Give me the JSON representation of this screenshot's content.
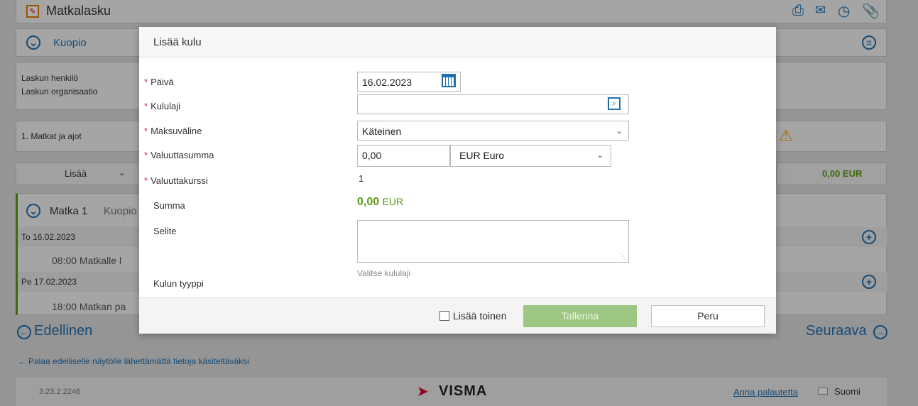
{
  "background": {
    "app_title": "Matkalasku",
    "location": "Kuopio",
    "person_label": "Laskun henkilö",
    "org_label": "Laskun organisaatio",
    "section_label": "1. Matkat ja ajot",
    "add_menu_label": "Lisää",
    "total_amount": "0,00 EUR",
    "trip_title": "Matka 1",
    "trip_location": "Kuopio",
    "day1": "To 16.02.2023",
    "day1_event": "08:00  Matkalle l",
    "day2": "Pe 17.02.2023",
    "day2_event": "18:00  Matkan pa",
    "prev_label": "Edellinen",
    "next_label": "Seuraava",
    "back_link": "Palaa edelliselle näytölle lähettämättä tietoja käsiteltäväksi",
    "version": "3.23.2.2246",
    "brand": "VISMA",
    "feedback_link": "Anna palautetta",
    "language": "Suomi"
  },
  "modal": {
    "title": "Lisää kulu",
    "fields": {
      "date_label": "Päivä",
      "date_value": "16.02.2023",
      "expense_type_label": "Kululaji",
      "expense_type_value": "",
      "payment_method_label": "Maksuväline",
      "payment_method_value": "Käteinen",
      "currency_amount_label": "Valuuttasumma",
      "currency_amount_value": "0,00",
      "currency_value": "EUR Euro",
      "exchange_rate_label": "Valuuttakurssi",
      "exchange_rate_value": "1",
      "sum_label": "Summa",
      "sum_value": "0,00",
      "sum_currency": "EUR",
      "description_label": "Selite",
      "description_value": "",
      "cost_type_label": "Kulun tyyppi",
      "cost_type_hint": "Valitse kululaji"
    },
    "footer": {
      "add_another_label": "Lisää toinen",
      "save_label": "Tallenna",
      "cancel_label": "Peru"
    }
  },
  "colors": {
    "accent_blue": "#1f6fae",
    "sum_green": "#5a9a16",
    "save_button": "#9dc782",
    "required": "#d9262e",
    "brand_red": "#d6002d"
  }
}
